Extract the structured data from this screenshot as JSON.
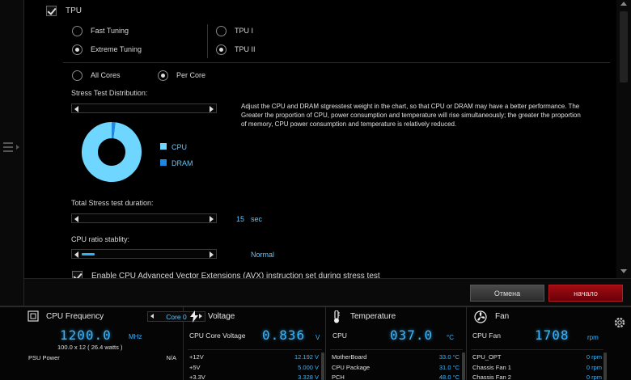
{
  "tpu": {
    "section_label": "TPU",
    "fast_tuning": "Fast Tuning",
    "extreme_tuning": "Extreme Tuning",
    "tpu1": "TPU I",
    "tpu2": "TPU II",
    "all_cores": "All Cores",
    "per_core": "Per Core",
    "stress_dist_label": "Stress Test Distribution:",
    "description": "Adjust the CPU and DRAM stgresstest weight in the chart, so that CPU or DRAM may have a better performance. The Greater the proportion of CPU, power consumption and temperature will rise simultaneously; the greater the proportion of memory, CPU power consumption and temperature is relatively reduced.",
    "legend": [
      {
        "label": "CPU",
        "color": "#6fd6ff"
      },
      {
        "label": "DRAM",
        "color": "#1e88e5"
      }
    ],
    "pie": {
      "cpu_fraction": 0.98,
      "dram_fraction": 0.02
    },
    "duration_label": "Total Stress test duration:",
    "duration_value": "15",
    "duration_unit": "sec",
    "duration_fraction": 0.0,
    "ratio_label": "CPU ratio stablity:",
    "ratio_value": "Normal",
    "ratio_fraction": 0.1,
    "avx_label": "Enable CPU Advanced Vector Extensions (AVX) instruction set during stress test"
  },
  "buttons": {
    "cancel": "Отмена",
    "start": "начало"
  },
  "colors": {
    "accent": "#38b6ff",
    "start_button": "#8b0a10"
  },
  "cpu_freq": {
    "title": "CPU Frequency",
    "core_select": "Core 0",
    "value": "1200.0",
    "unit": "MHz",
    "sub": "100.0  x 12   ( 26.4 watts )",
    "psu_label": "PSU Power",
    "psu_value": "N/A"
  },
  "voltage": {
    "title": "Voltage",
    "main_label": "CPU Core Voltage",
    "main_value": "0.836",
    "main_unit": "V",
    "rows": [
      {
        "label": "+12V",
        "value": "12.192 V"
      },
      {
        "label": "+5V",
        "value": "5.000 V"
      },
      {
        "label": "+3.3V",
        "value": "3.328 V"
      }
    ]
  },
  "temperature": {
    "title": "Temperature",
    "main_label": "CPU",
    "main_value": "037.0",
    "main_unit": "°C",
    "rows": [
      {
        "label": "MotherBoard",
        "value": "33.0 °C"
      },
      {
        "label": "CPU Package",
        "value": "31.0 °C"
      },
      {
        "label": "PCH",
        "value": "48.0 °C"
      }
    ]
  },
  "fan": {
    "title": "Fan",
    "main_label": "CPU Fan",
    "main_value": "1708",
    "main_unit": "rpm",
    "rows": [
      {
        "label": "CPU_OPT",
        "value": "0  rpm"
      },
      {
        "label": "Chassis Fan 1",
        "value": "0  rpm"
      },
      {
        "label": "Chassis Fan 2",
        "value": "0  rpm"
      }
    ]
  }
}
